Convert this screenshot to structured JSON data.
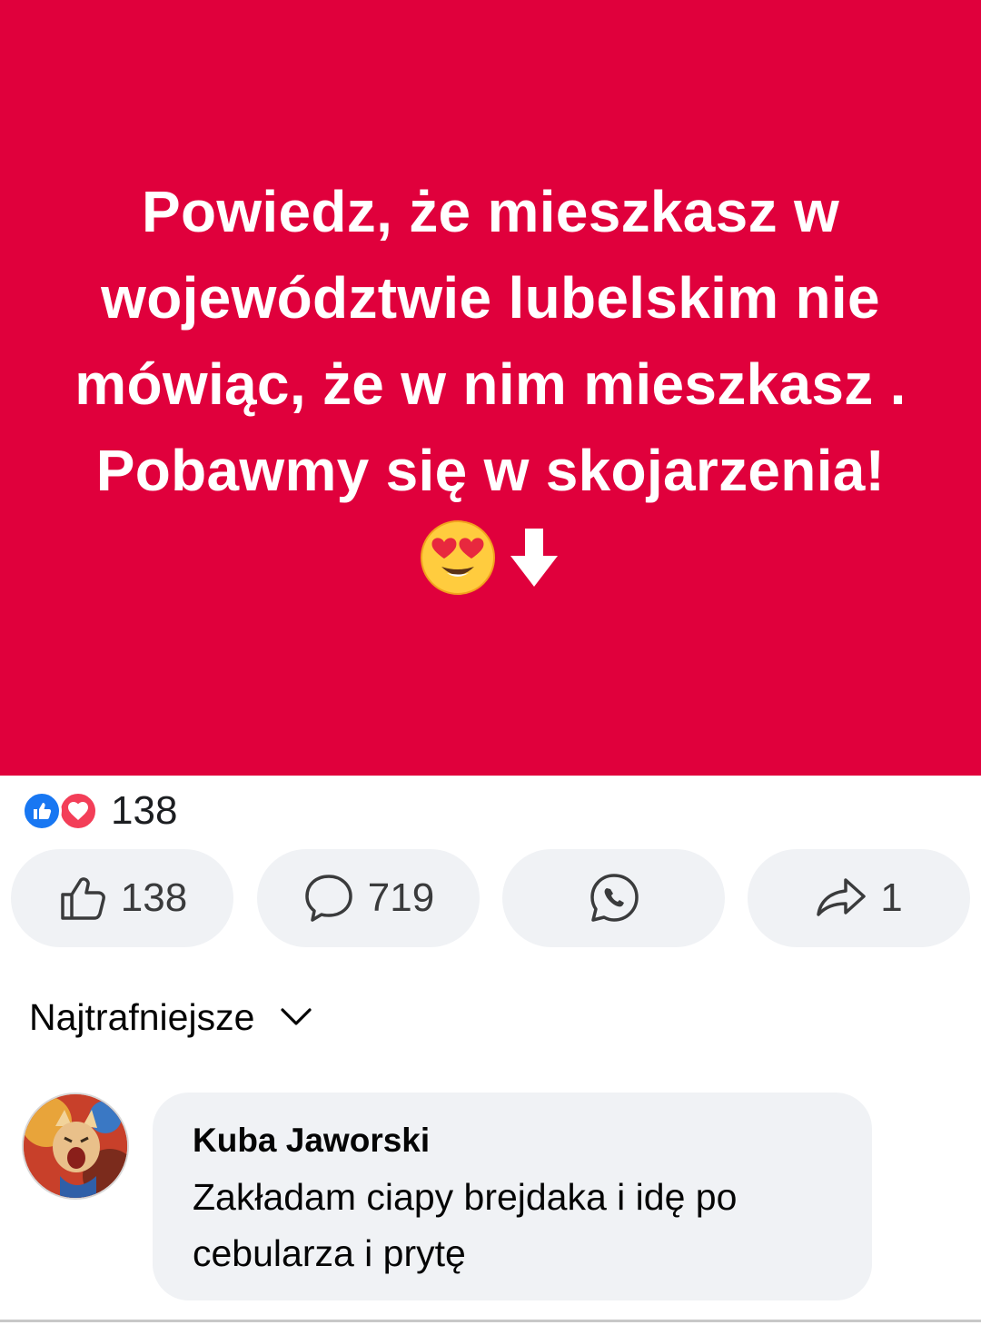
{
  "post": {
    "text_line1": "Powiedz, że mieszkasz w",
    "text_line2": "województwie lubelskim nie",
    "text_line3": "mówiąc, że w nim mieszkasz .",
    "text_line4": "Pobawmy się w skojarzenia!",
    "background_color": "#e0003c",
    "emojis": [
      "heart-eyes-emoji",
      "down-arrow-emoji"
    ]
  },
  "reactions": {
    "icons": [
      "like-reaction-icon",
      "love-reaction-icon"
    ],
    "count": "138"
  },
  "actions": {
    "like_count": "138",
    "comment_count": "719",
    "whatsapp_icon": "whatsapp-icon",
    "share_count": "1"
  },
  "comments_sort": {
    "label": "Najtrafniejsze"
  },
  "comment": {
    "author": "Kuba Jaworski",
    "text_line1": "Zakładam ciapy brejdaka i idę po",
    "text_line2": "cebularza i prytę"
  }
}
